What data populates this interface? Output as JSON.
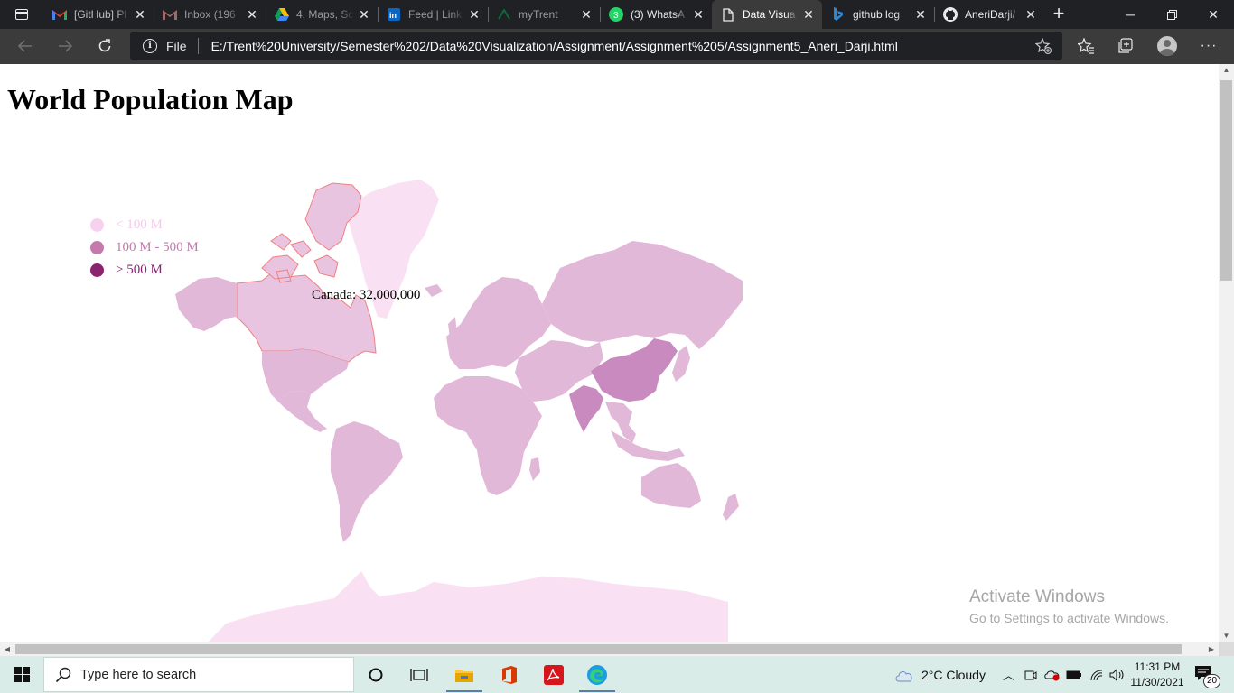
{
  "browser": {
    "tabs": [
      {
        "label": "[GitHub] Pl",
        "icon": "gmail-icon",
        "active": false
      },
      {
        "label": "Inbox (196",
        "icon": "gmail-icon",
        "active": false
      },
      {
        "label": "4. Maps, Sc",
        "icon": "google-drive-icon",
        "active": false
      },
      {
        "label": "Feed | Link",
        "icon": "linkedin-icon",
        "active": false
      },
      {
        "label": "myTrent",
        "icon": "trent-icon",
        "active": false
      },
      {
        "label": "(3) WhatsA",
        "icon": "whatsapp-icon",
        "active": false,
        "badge": "3"
      },
      {
        "label": "Data Visua",
        "icon": "page-icon",
        "active": true
      },
      {
        "label": "github log",
        "icon": "bing-icon",
        "active": false
      },
      {
        "label": "AneriDarji/",
        "icon": "github-icon",
        "active": false
      }
    ],
    "address": {
      "scheme_label": "File",
      "url": "E:/Trent%20University/Semester%202/Data%20Visualization/Assignment/Assignment%205/Assignment5_Aneri_Darji.html"
    }
  },
  "page": {
    "title": "World Population Map",
    "legend": [
      {
        "label": "< 100 M",
        "color": "#f7d2ee"
      },
      {
        "label": "100 M - 500 M",
        "color": "#c47aad"
      },
      {
        "label": "> 500 M",
        "color": "#8b2470"
      }
    ],
    "tooltip": {
      "country": "Canada",
      "population": "32,000,000",
      "text": "Canada: 32,000,000"
    },
    "map_colors": {
      "default_fill": "#e2b8d8",
      "light_fill": "#f9e1f3",
      "dark_fill": "#c98bbf",
      "hover_stroke": "#f08080"
    }
  },
  "watermark": {
    "line1": "Activate Windows",
    "line2": "Go to Settings to activate Windows."
  },
  "taskbar": {
    "search_placeholder": "Type here to search",
    "weather": "2°C  Cloudy",
    "time": "11:31 PM",
    "date": "11/30/2021",
    "notification_count": "20"
  }
}
